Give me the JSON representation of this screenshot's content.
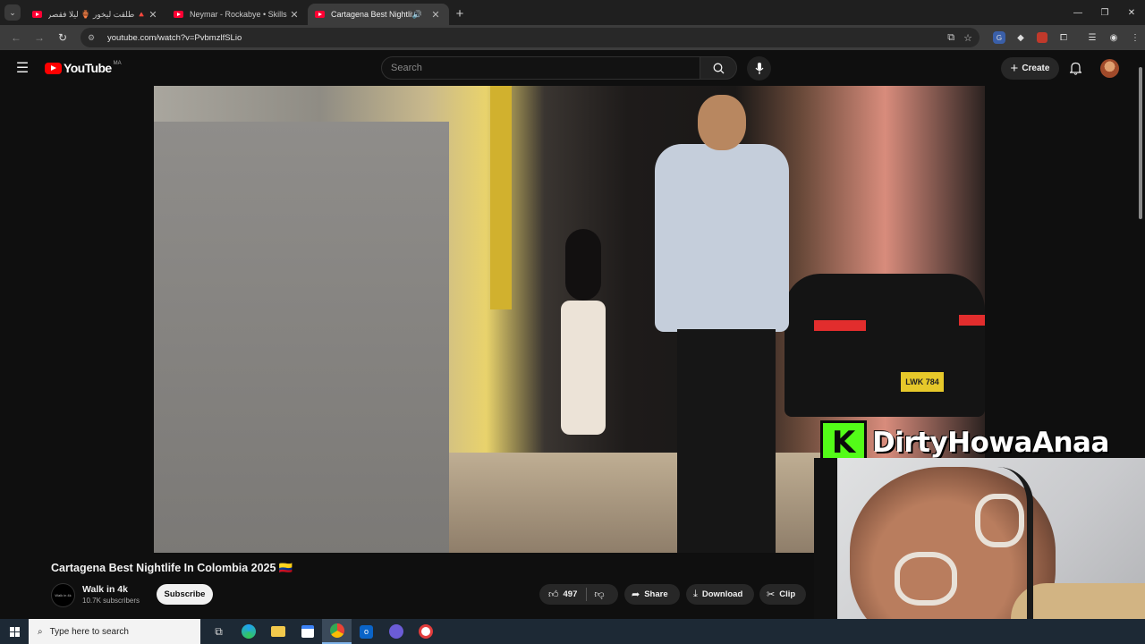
{
  "browser": {
    "tabs": [
      {
        "title": "🔺 طلقت ليخور 🏺 ليلا فقصر ه",
        "active": false
      },
      {
        "title": "Neymar - Rockabye • Skills & Goals",
        "active": false
      },
      {
        "title": "Cartagena Best Nightlife In",
        "active": true
      }
    ],
    "url": "youtube.com/watch?v=PvbmzlfSLio"
  },
  "youtube": {
    "logo_text": "YouTube",
    "country_code": "MA",
    "search_placeholder": "Search",
    "create_label": "Create"
  },
  "video": {
    "plate_text": "LWK 784",
    "title": "Cartagena Best Nightlife In Colombia 2025 🇨🇴",
    "channel": "Walk in 4k",
    "channel_avatar_text": "Walk in 4k",
    "subscribers": "10.7K subscribers",
    "subscribe_label": "Subscribe",
    "likes": "497",
    "share_label": "Share",
    "download_label": "Download",
    "clip_label": "Clip"
  },
  "stream_overlay": {
    "brand_letter": "K",
    "streamer_name": "DirtyHowaAnaa"
  },
  "taskbar": {
    "search_placeholder": "Type here to search"
  },
  "colors": {
    "yt_red": "#ff0000",
    "kick_green": "#53fc18",
    "background": "#0f0f0f"
  }
}
